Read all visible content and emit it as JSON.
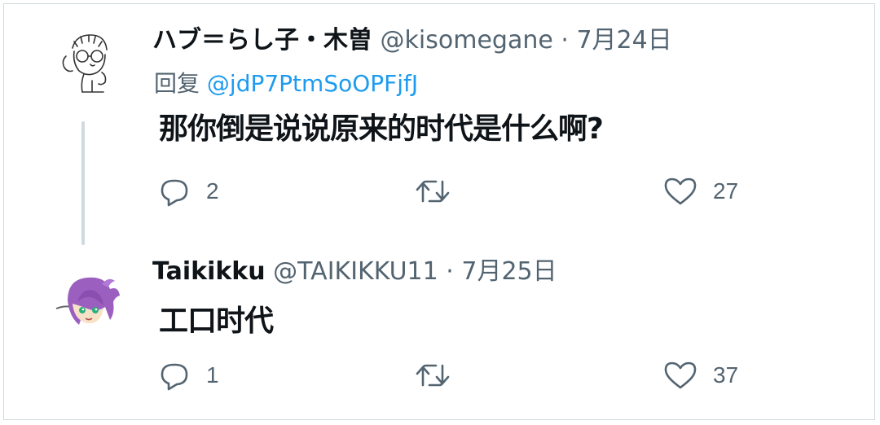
{
  "tweets": [
    {
      "display_name": "ハブ＝らし子・木曽",
      "handle": "@kisomegane",
      "separator": "·",
      "date": "7月24日",
      "reply_prefix": "回复",
      "reply_to": "@jdP7PtmSoOPFjfJ",
      "text": "那你倒是说说原来的时代是什么啊?",
      "reply_count": "2",
      "retweet_count": "",
      "like_count": "27",
      "avatar_icon": "line-drawing-avatar-icon"
    },
    {
      "display_name": "Taikikku",
      "handle": "@TAIKIKKU11",
      "separator": "·",
      "date": "7月25日",
      "text": "工口时代",
      "reply_count": "1",
      "retweet_count": "",
      "like_count": "37",
      "avatar_icon": "purple-hair-anime-avatar-icon"
    }
  ],
  "colors": {
    "text": "#0f1419",
    "secondary": "#536471",
    "link": "#1d9bf0",
    "border": "#cfd9de"
  }
}
